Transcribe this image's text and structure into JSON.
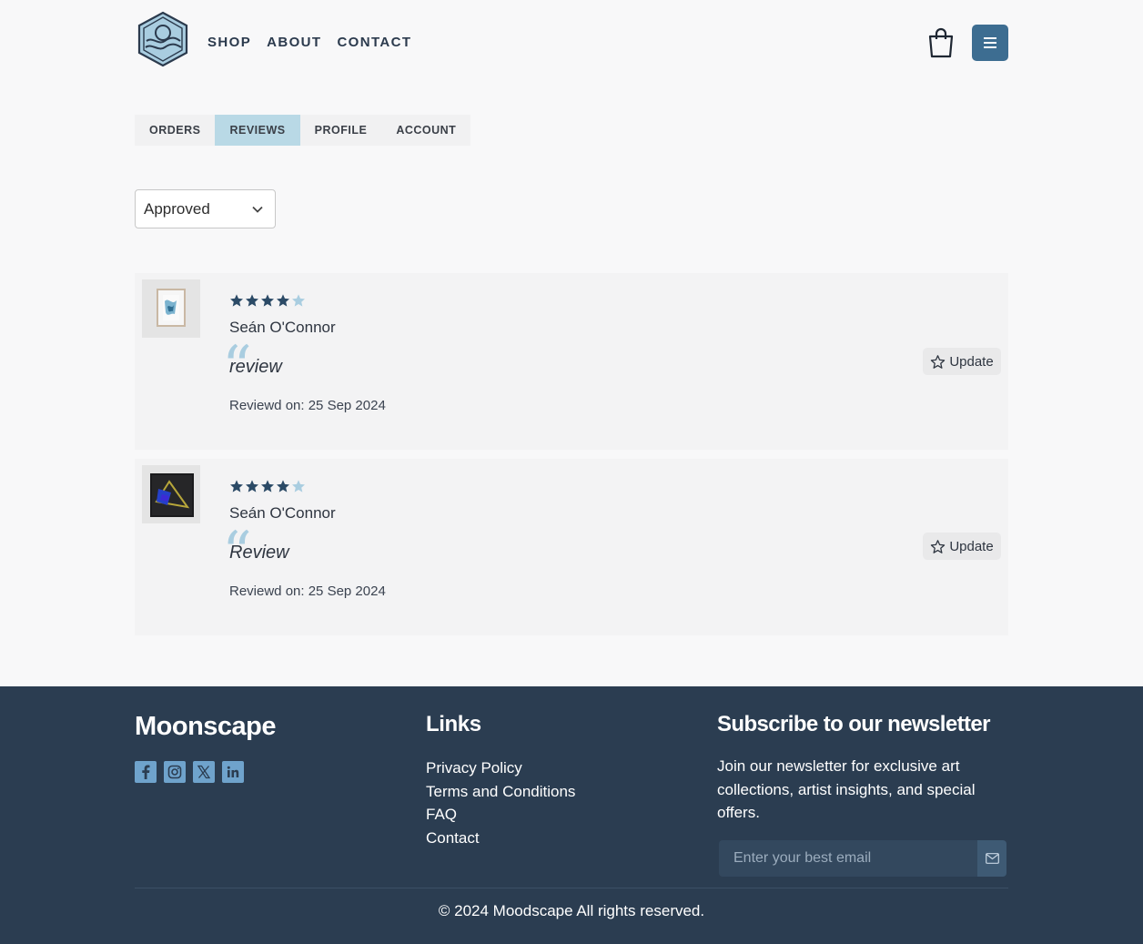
{
  "header": {
    "nav": [
      {
        "label": "SHOP"
      },
      {
        "label": "ABOUT"
      },
      {
        "label": "CONTACT"
      }
    ]
  },
  "tabs": [
    {
      "label": "ORDERS",
      "active": false
    },
    {
      "label": "REVIEWS",
      "active": true
    },
    {
      "label": "PROFILE",
      "active": false
    },
    {
      "label": "ACCOUNT",
      "active": false
    }
  ],
  "filter": {
    "selected": "Approved"
  },
  "reviews": [
    {
      "rating": 4,
      "max_rating": 5,
      "reviewer": "Seán O'Connor",
      "text": "review",
      "date": "Reviewd on: 25 Sep 2024",
      "update_label": "Update"
    },
    {
      "rating": 4,
      "max_rating": 5,
      "reviewer": "Seán O'Connor",
      "text": "Review",
      "date": "Reviewd on: 25 Sep 2024",
      "update_label": "Update"
    }
  ],
  "footer": {
    "brand": "Moonscape",
    "socials": [
      "facebook-icon",
      "instagram-icon",
      "x-icon",
      "linkedin-icon"
    ],
    "links_title": "Links",
    "links": [
      {
        "label": "Privacy Policy"
      },
      {
        "label": "Terms and Conditions"
      },
      {
        "label": "FAQ"
      },
      {
        "label": "Contact"
      }
    ],
    "newsletter_title": "Subscribe to our newsletter",
    "newsletter_text": "Join our newsletter for exclusive art collections, artist insights, and special offers.",
    "email_placeholder": "Enter your best email",
    "copyright": "© 2024 Moodscape All rights reserved."
  },
  "colors": {
    "accent": "#3d6d91",
    "tab_active": "#b9d9e6",
    "star_filled": "#2b4a66",
    "star_empty": "#a9cde0",
    "footer_bg": "#2b3d51"
  }
}
